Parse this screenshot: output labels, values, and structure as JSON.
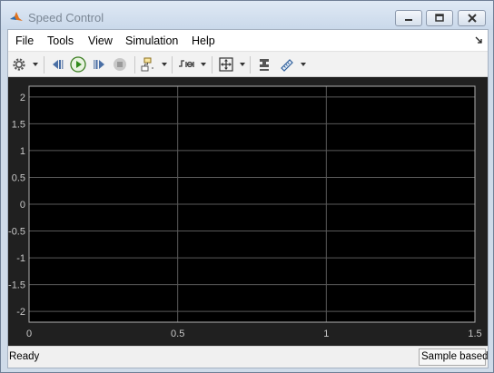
{
  "window": {
    "title": "Speed Control",
    "controls": [
      "minimize-icon",
      "maximize-icon",
      "close-icon"
    ]
  },
  "menu": {
    "items": [
      {
        "label": "File"
      },
      {
        "label": "Tools"
      },
      {
        "label": "View"
      },
      {
        "label": "Simulation"
      },
      {
        "label": "Help"
      }
    ]
  },
  "toolbar": {
    "buttons": [
      {
        "name": "configuration-properties",
        "icon": "gear-icon",
        "dropdown": true
      },
      {
        "name": "step-back",
        "icon": "step-back-icon"
      },
      {
        "name": "run",
        "icon": "run-icon"
      },
      {
        "name": "step-forward",
        "icon": "step-forward-icon"
      },
      {
        "name": "stop",
        "icon": "stop-icon"
      },
      {
        "name": "highlight-block",
        "icon": "highlight-block-icon",
        "dropdown": true
      },
      {
        "name": "triggers",
        "icon": "trigger-icon",
        "dropdown": true
      },
      {
        "name": "scale-axes",
        "icon": "zoom-fit-icon",
        "dropdown": true
      },
      {
        "name": "legend-style",
        "icon": "legend-icon"
      },
      {
        "name": "measurements",
        "icon": "ruler-icon",
        "dropdown": true
      }
    ]
  },
  "scope": {
    "colors": {
      "axes_background": "#000000",
      "figure_background": "#202020",
      "grid": "#5a5a5a",
      "tick_text": "#c8c8c8"
    },
    "x_ticks": [
      "0",
      "0.5",
      "1",
      "1.5"
    ],
    "y_ticks": [
      "2",
      "1.5",
      "1",
      "0.5",
      "0",
      "-0.5",
      "-1",
      "-1.5",
      "-2"
    ]
  },
  "chart_data": {
    "type": "line",
    "xlim": [
      0,
      1.5
    ],
    "ylim": [
      -2.2,
      2.2
    ],
    "x_ticks": [
      0,
      0.5,
      1,
      1.5
    ],
    "y_ticks": [
      2,
      1.5,
      1,
      0.5,
      0,
      -0.5,
      -1,
      -1.5,
      -2
    ],
    "series": [],
    "grid": true
  },
  "status": {
    "text": "Ready",
    "mode": "Sample based"
  }
}
